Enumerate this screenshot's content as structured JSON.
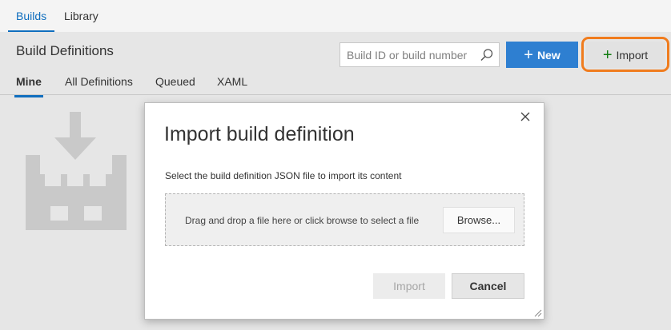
{
  "top_tabs": [
    {
      "label": "Builds",
      "active": true
    },
    {
      "label": "Library",
      "active": false
    }
  ],
  "header": {
    "title": "Build Definitions",
    "search_placeholder": "Build ID or build number",
    "search_icon": "search-icon",
    "new_button": {
      "icon": "+",
      "label": "New"
    },
    "import_button": {
      "icon": "+",
      "label": "Import"
    }
  },
  "pivots": [
    {
      "label": "Mine",
      "active": true
    },
    {
      "label": "All Definitions",
      "active": false
    },
    {
      "label": "Queued",
      "active": false
    },
    {
      "label": "XAML",
      "active": false
    }
  ],
  "dialog": {
    "title": "Import build definition",
    "description": "Select the build definition JSON file to import its content",
    "dropzone_text": "Drag and drop a file here or click browse to select a file",
    "browse_label": "Browse...",
    "import_label": "Import",
    "import_enabled": false,
    "cancel_label": "Cancel"
  },
  "colors": {
    "accent": "#106ebe",
    "primary_button": "#2e7fd1",
    "highlight_ring": "#f07c1e",
    "plus_green": "#107c10"
  }
}
